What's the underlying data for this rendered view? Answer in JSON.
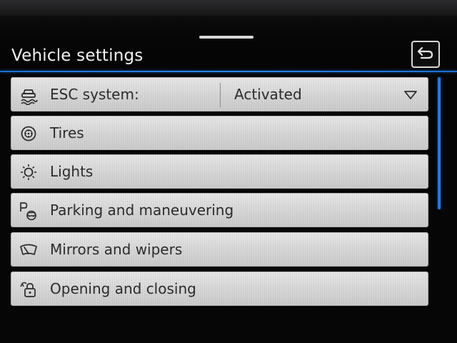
{
  "header": {
    "title": "Vehicle settings"
  },
  "menu": {
    "items": [
      {
        "label": "ESC system:",
        "value": "Activated",
        "icon": "esc-icon"
      },
      {
        "label": "Tires",
        "icon": "tire-icon"
      },
      {
        "label": "Lights",
        "icon": "light-bulb-icon"
      },
      {
        "label": "Parking and maneuvering",
        "icon": "parking-icon"
      },
      {
        "label": "Mirrors and wipers",
        "icon": "wiper-icon"
      },
      {
        "label": "Opening and closing",
        "icon": "lock-icon"
      }
    ]
  },
  "colors": {
    "accent": "#2b86f0",
    "background": "#060607",
    "row": "#d6d6d6",
    "text_dark": "#2b2b2b",
    "text_light": "#f2f2f2"
  }
}
